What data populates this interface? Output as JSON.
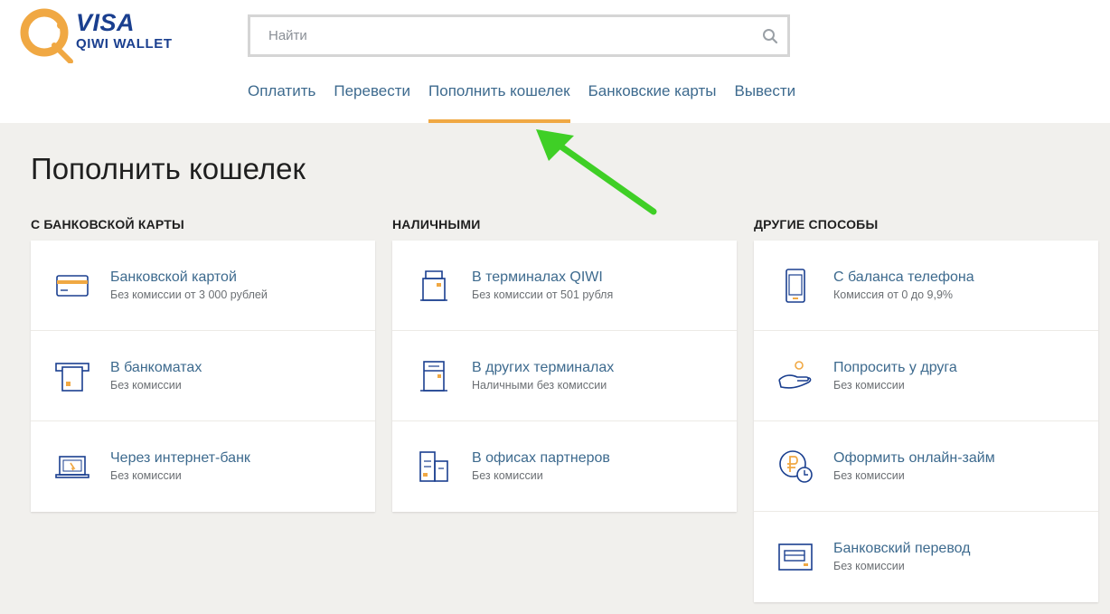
{
  "logo": {
    "visa": "VISA",
    "wallet": "QIWI WALLET"
  },
  "search": {
    "placeholder": "Найти"
  },
  "nav": {
    "items": [
      {
        "label": "Оплатить"
      },
      {
        "label": "Перевести"
      },
      {
        "label": "Пополнить кошелек"
      },
      {
        "label": "Банковские карты"
      },
      {
        "label": "Вывести"
      }
    ]
  },
  "colors": {
    "accent": "#f0a843",
    "link": "#3d6a8e",
    "icon": "#1a3f8f",
    "arrow": "#3fcf26"
  },
  "page": {
    "title": "Пополнить кошелек"
  },
  "columns": [
    {
      "title": "С банковской карты",
      "items": [
        {
          "label": "Банковской картой",
          "sub": "Без комиссии от 3 000 рублей",
          "icon": "bank-card-icon"
        },
        {
          "label": "В банкоматах",
          "sub": "Без комиссии",
          "icon": "atm-icon"
        },
        {
          "label": "Через интернет-банк",
          "sub": "Без комиссии",
          "icon": "laptop-icon"
        }
      ]
    },
    {
      "title": "Наличными",
      "items": [
        {
          "label": "В терминалах QIWI",
          "sub": "Без комиссии от 501 рубля",
          "icon": "terminal-icon"
        },
        {
          "label": "В других терминалах",
          "sub": "Наличными без комиссии",
          "icon": "other-terminal-icon"
        },
        {
          "label": "В офисах партнеров",
          "sub": "Без комиссии",
          "icon": "office-icon"
        }
      ]
    },
    {
      "title": "Другие способы",
      "items": [
        {
          "label": "С баланса телефона",
          "sub": "Комиссия от 0 до 9,9%",
          "icon": "phone-icon"
        },
        {
          "label": "Попросить у друга",
          "sub": "Без комиссии",
          "icon": "hand-coin-icon"
        },
        {
          "label": "Оформить онлайн-займ",
          "sub": "Без комиссии",
          "icon": "ruble-clock-icon"
        },
        {
          "label": "Банковский перевод",
          "sub": "Без комиссии",
          "icon": "bank-transfer-icon"
        }
      ]
    }
  ]
}
